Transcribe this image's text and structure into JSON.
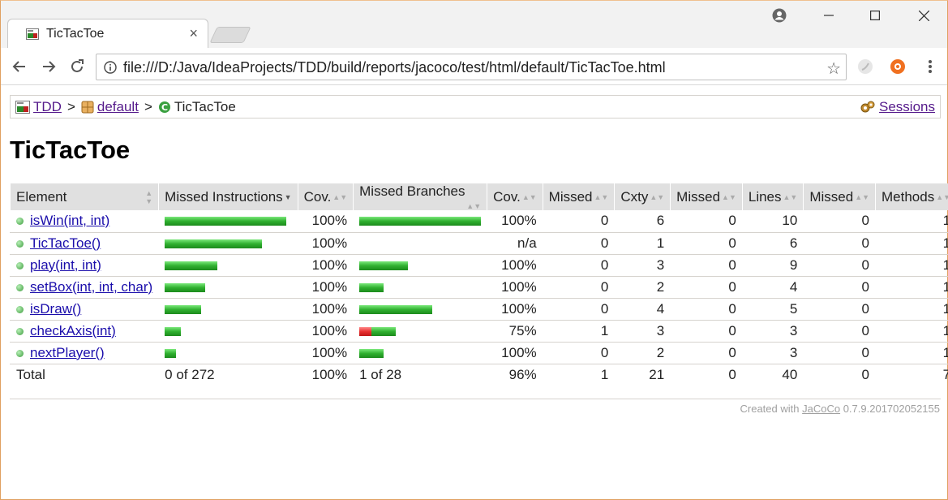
{
  "browser": {
    "tab_title": "TicTacToe",
    "url": "file:///D:/Java/IdeaProjects/TDD/build/reports/jacoco/test/html/default/TicTacToe.html"
  },
  "breadcrumb": {
    "project": "TDD",
    "separator": ">",
    "package": "default",
    "current": "TicTacToe",
    "sessions": "Sessions"
  },
  "page": {
    "title": "TicTacToe"
  },
  "table": {
    "headers": {
      "element": "Element",
      "missed_instructions": "Missed Instructions",
      "cov1": "Cov.",
      "missed_branches": "Missed Branches",
      "cov2": "Cov.",
      "missed_cxty": "Missed",
      "cxty": "Cxty",
      "missed_lines": "Missed",
      "lines": "Lines",
      "missed_methods": "Missed",
      "methods": "Methods"
    },
    "rows": [
      {
        "name": "isWin(int, int)",
        "instr_fraction": 1.0,
        "instr_cov": "100%",
        "branch_fraction": 1.0,
        "branch_missed_fraction": 0,
        "branch_cov": "100%",
        "missed_cxty": "0",
        "cxty": "6",
        "missed_lines": "0",
        "lines": "10",
        "missed_methods": "0",
        "methods": "1"
      },
      {
        "name": "TicTacToe()",
        "instr_fraction": 0.8,
        "instr_cov": "100%",
        "branch_fraction": 0,
        "branch_missed_fraction": 0,
        "branch_cov": "n/a",
        "missed_cxty": "0",
        "cxty": "1",
        "missed_lines": "0",
        "lines": "6",
        "missed_methods": "0",
        "methods": "1"
      },
      {
        "name": "play(int, int)",
        "instr_fraction": 0.43,
        "instr_cov": "100%",
        "branch_fraction": 0.4,
        "branch_missed_fraction": 0,
        "branch_cov": "100%",
        "missed_cxty": "0",
        "cxty": "3",
        "missed_lines": "0",
        "lines": "9",
        "missed_methods": "0",
        "methods": "1"
      },
      {
        "name": "setBox(int, int, char)",
        "instr_fraction": 0.33,
        "instr_cov": "100%",
        "branch_fraction": 0.2,
        "branch_missed_fraction": 0,
        "branch_cov": "100%",
        "missed_cxty": "0",
        "cxty": "2",
        "missed_lines": "0",
        "lines": "4",
        "missed_methods": "0",
        "methods": "1"
      },
      {
        "name": "isDraw()",
        "instr_fraction": 0.3,
        "instr_cov": "100%",
        "branch_fraction": 0.6,
        "branch_missed_fraction": 0,
        "branch_cov": "100%",
        "missed_cxty": "0",
        "cxty": "4",
        "missed_lines": "0",
        "lines": "5",
        "missed_methods": "0",
        "methods": "1"
      },
      {
        "name": "checkAxis(int)",
        "instr_fraction": 0.13,
        "instr_cov": "100%",
        "branch_fraction": 0.3,
        "branch_missed_fraction": 0.1,
        "branch_cov": "75%",
        "missed_cxty": "1",
        "cxty": "3",
        "missed_lines": "0",
        "lines": "3",
        "missed_methods": "0",
        "methods": "1"
      },
      {
        "name": "nextPlayer()",
        "instr_fraction": 0.09,
        "instr_cov": "100%",
        "branch_fraction": 0.2,
        "branch_missed_fraction": 0,
        "branch_cov": "100%",
        "missed_cxty": "0",
        "cxty": "2",
        "missed_lines": "0",
        "lines": "3",
        "missed_methods": "0",
        "methods": "1"
      }
    ],
    "total": {
      "label": "Total",
      "instructions": "0 of 272",
      "instr_cov": "100%",
      "branches": "1 of 28",
      "branch_cov": "96%",
      "missed_cxty": "1",
      "cxty": "21",
      "missed_lines": "0",
      "lines": "40",
      "missed_methods": "0",
      "methods": "7"
    }
  },
  "footer": {
    "prefix": "Created with",
    "link": "JaCoCo",
    "version": "0.7.9.201702052155"
  },
  "colors": {
    "covered": "#2fb02f",
    "missed": "#e83030",
    "header_bg": "#e0e0e0"
  }
}
